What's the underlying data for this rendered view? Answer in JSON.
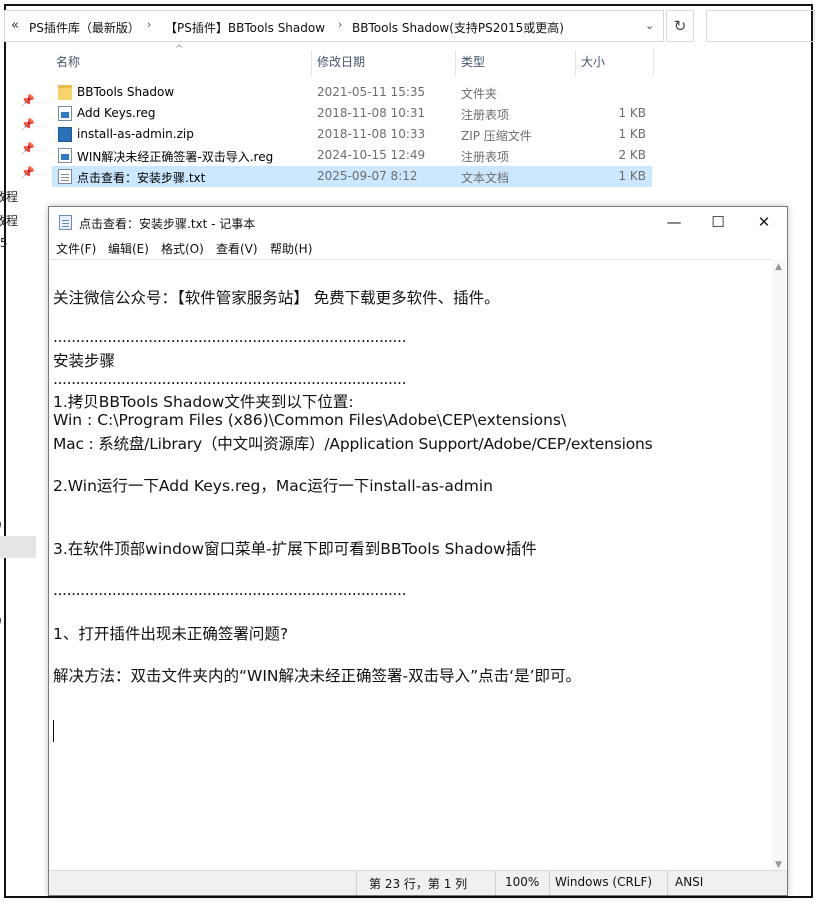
{
  "explorer": {
    "breadcrumb": [
      "PS插件库（最新版）",
      "【PS插件】BBTools Shadow",
      "BBTools Shadow(支持PS2015或更高)"
    ],
    "columns": {
      "name": "名称",
      "date": "修改日期",
      "type": "类型",
      "size": "大小"
    },
    "files": [
      {
        "name": "BBTools Shadow",
        "date": "2021-05-11 15:35",
        "type": "文件夹",
        "size": "",
        "icon": "folder-icon"
      },
      {
        "name": "Add Keys.reg",
        "date": "2018-11-08 10:31",
        "type": "注册表项",
        "size": "1 KB",
        "icon": "reg-file-icon"
      },
      {
        "name": "install-as-admin.zip",
        "date": "2018-11-08 10:33",
        "type": "ZIP 压缩文件",
        "size": "1 KB",
        "icon": "zip-file-icon"
      },
      {
        "name": "WIN解决未经正确签署-双击导入.reg",
        "date": "2024-10-15 12:49",
        "type": "注册表项",
        "size": "2 KB",
        "icon": "reg-file-icon"
      },
      {
        "name": "点击查看：安装步骤.txt",
        "date": "2025-09-07 8:12",
        "type": "文本文档",
        "size": "1 KB",
        "icon": "txt-file-icon"
      }
    ],
    "left_slivers": [
      "教程",
      "教程",
      ".5",
      "0",
      "0"
    ]
  },
  "notepad": {
    "title": "点击查看：安装步骤.txt - 记事本",
    "menu": [
      "文件(F)",
      "编辑(E)",
      "格式(O)",
      "查看(V)",
      "帮助(H)"
    ],
    "lines": [
      "关注微信公众号：【软件管家服务站】 免费下载更多软件、插件。",
      "..............................................................................",
      "安装步骤",
      "..............................................................................",
      "1.拷贝BBTools Shadow文件夹到以下位置:",
      "Win : C:\\Program Files (x86)\\Common Files\\Adobe\\CEP\\extensions\\",
      "Mac : 系统盘/Library（中文叫资源库）/Application Support/Adobe/CEP/extensions",
      "2.Win运行一下Add Keys.reg，Mac运行一下install-as-admin",
      "3.在软件顶部window窗口菜单-扩展下即可看到BBTools Shadow插件",
      "..............................................................................",
      "1、打开插件出现未正确签署问题?",
      "解决方法：双击文件夹内的“WIN解决未经正确签署-双击导入”点击‘是’即可。"
    ],
    "status": {
      "position": "第 23 行，第 1 列",
      "zoom": "100%",
      "eol": "Windows (CRLF)",
      "encoding": "ANSI"
    }
  }
}
